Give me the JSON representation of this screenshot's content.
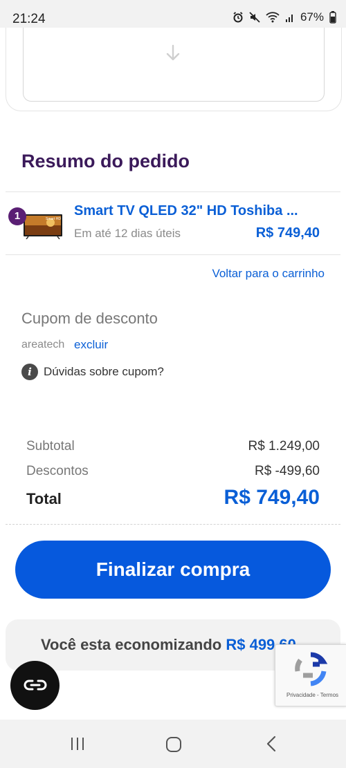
{
  "status_bar": {
    "time": "21:24",
    "battery": "67%",
    "icons": [
      "alarm-icon",
      "mute-icon",
      "wifi-icon",
      "signal-icon",
      "battery-icon"
    ]
  },
  "upload": {
    "icon": "arrow-down-icon"
  },
  "summary": {
    "title": "Resumo do pedido",
    "product": {
      "quantity": "1",
      "name": "Smart TV QLED 32\" HD Toshiba ...",
      "delivery": "Em até 12 dias úteis",
      "price": "R$ 749,40",
      "thumb_label": "Smart HD"
    },
    "back_to_cart": "Voltar para o carrinho"
  },
  "coupon": {
    "title": "Cupom de desconto",
    "code": "areatech",
    "remove_label": "excluir",
    "help_text": "Dúvidas sobre cupom?"
  },
  "totals": {
    "subtotal_label": "Subtotal",
    "subtotal_value": "R$ 1.249,00",
    "discount_label": "Descontos",
    "discount_value": "R$ -499,60",
    "total_label": "Total",
    "total_value": "R$ 749,40"
  },
  "checkout": {
    "button_label": "Finalizar compra"
  },
  "savings": {
    "text": "Você esta economizando",
    "amount": "R$ 499,60"
  },
  "recaptcha": {
    "privacy": "Privacidade",
    "separator": "-",
    "terms": "Termos"
  },
  "colors": {
    "accent": "#0659dd",
    "link": "#0a5fd6",
    "title": "#3b1a5a",
    "badge": "#5a1f74"
  }
}
